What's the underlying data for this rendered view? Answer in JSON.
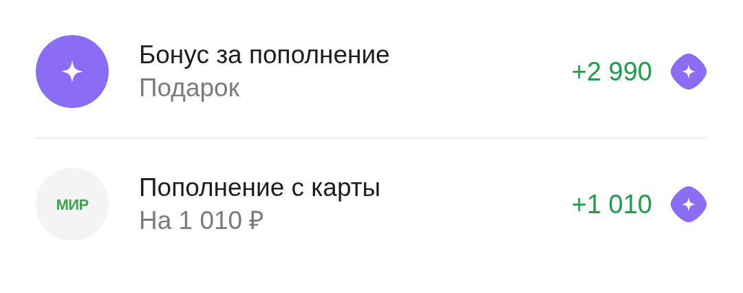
{
  "transactions": [
    {
      "kind": "bonus",
      "title": "Бонус за пополнение",
      "subtitle": "Подарок",
      "amount": "+2 990"
    },
    {
      "kind": "card",
      "logo_text": "МИР",
      "title": "Пополнение с карты",
      "subtitle": "На 1 010 ₽",
      "amount": "+1 010"
    }
  ]
}
